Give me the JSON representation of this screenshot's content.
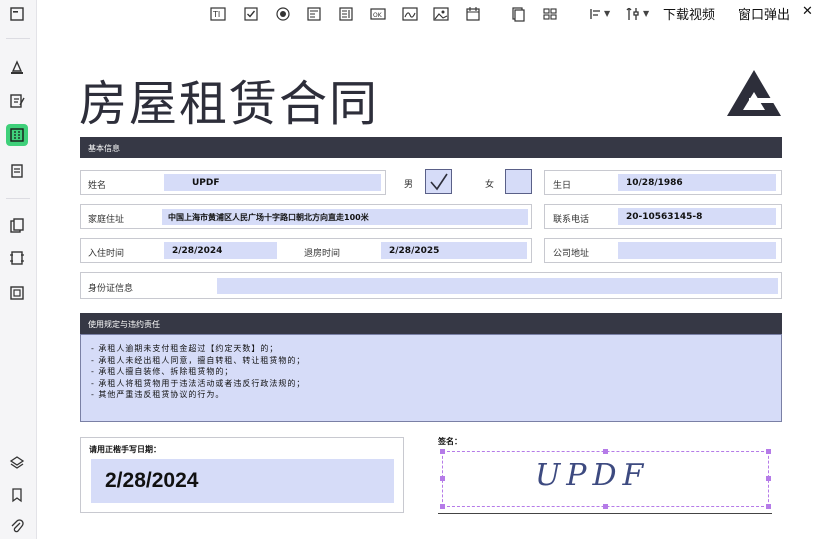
{
  "toolbar": {
    "icons": [
      "text-field-icon",
      "checkbox-icon",
      "radio-icon",
      "combobox-icon",
      "listbox-icon",
      "button-ok-icon",
      "signature-field-icon",
      "image-field-icon",
      "date-field-icon",
      "align-icon",
      "grid-icon",
      "alignment-menu-icon",
      "tools-icon"
    ],
    "download_video": "下载视频",
    "popup_window": "窗口弹出",
    "close": "✕"
  },
  "sidebar": {
    "items": [
      "edit-page-icon",
      "highlight-icon",
      "edit-text-icon",
      "form-icon",
      "page-organize-icon",
      "convert-icon",
      "ocr-icon",
      "compress-icon",
      "layers-icon",
      "bookmark-icon",
      "attachment-icon"
    ],
    "active": "form-icon"
  },
  "document": {
    "title": "房屋租赁合同",
    "section_basic": "基本信息",
    "name_label": "姓名",
    "name_value": "UPDF",
    "male_label": "男",
    "female_label": "女",
    "male_checked": true,
    "female_checked": false,
    "birthday_label": "生日",
    "birthday_value": "10/28/1986",
    "address_label": "家庭住址",
    "address_value": "中国上海市黄浦区人民广场十字路口朝北方向直走100米",
    "phone_label": "联系电话",
    "phone_value": "20-10563145-8",
    "checkin_label": "入住时间",
    "checkin_value": "2/28/2024",
    "checkout_label": "退房时间",
    "checkout_value": "2/28/2025",
    "company_label": "公司地址",
    "company_value": "",
    "id_label": "身份证信息",
    "id_value": "",
    "section_rules": "使用规定与违约责任",
    "rules": [
      "- 承租人逾期未支付租金超过【约定天数】的；",
      "- 承租人未经出租人同意，擅自转租、转让租赁物的；",
      "- 承租人擅自装修、拆除租赁物的；",
      "- 承租人将租赁物用于违法活动或者违反行政法规的；",
      "- 其他严重违反租赁协议的行为。"
    ],
    "date_label": "请用正楷手写日期：",
    "date_value": "2/28/2024",
    "signature_label": "签名：",
    "signature_value": "UPDF"
  },
  "colors": {
    "accent_green": "#3fd07a",
    "section_bar": "#363845",
    "field_fill": "#d6dcf8",
    "selection": "#b57be8"
  }
}
